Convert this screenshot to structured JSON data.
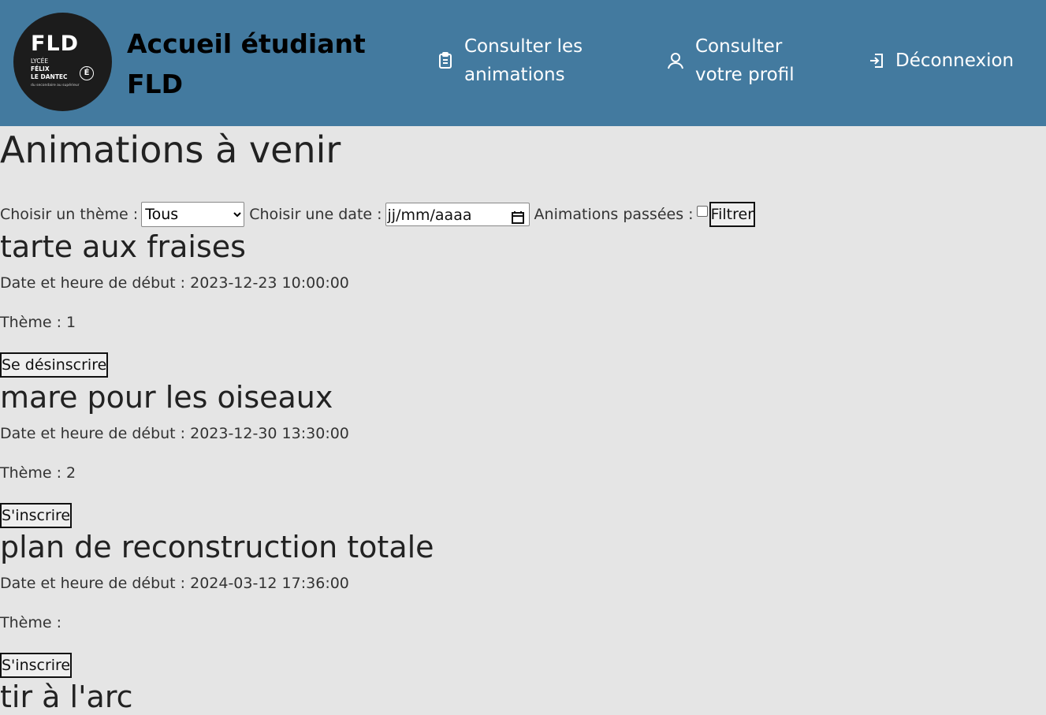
{
  "header": {
    "logo": {
      "big": "FLD",
      "line1": "LYCÉE",
      "line2": "FÉLIX",
      "line3": "LE DANTEC",
      "mark": "É",
      "tagline": "du secondaire au supérieur"
    },
    "title": "Accueil étudiant FLD",
    "nav": [
      {
        "label": "Consulter les animations",
        "icon": "clipboard-icon"
      },
      {
        "label": "Consulter votre profil",
        "icon": "user-icon"
      },
      {
        "label": "Déconnexion",
        "icon": "logout-icon"
      }
    ]
  },
  "page": {
    "title": "Animations à venir"
  },
  "filters": {
    "theme_label": "Choisir un thème :",
    "theme_selected": "Tous",
    "date_label": "Choisir une date :",
    "date_placeholder": "jj/mm/aaaa",
    "past_label": "Animations passées :",
    "past_checked": false,
    "submit_label": "Filtrer"
  },
  "animations": [
    {
      "title": "tarte aux fraises",
      "date_line": "Date et heure de début : 2023-12-23 10:00:00",
      "theme_line": "Thème : 1",
      "action": "Se désinscrire"
    },
    {
      "title": "mare pour les oiseaux",
      "date_line": "Date et heure de début : 2023-12-30 13:30:00",
      "theme_line": "Thème : 2",
      "action": "S'inscrire"
    },
    {
      "title": "plan de reconstruction totale",
      "date_line": "Date et heure de début : 2024-03-12 17:36:00",
      "theme_line": "Thème :",
      "action": "S'inscrire"
    },
    {
      "title": "tir à l'arc"
    }
  ]
}
